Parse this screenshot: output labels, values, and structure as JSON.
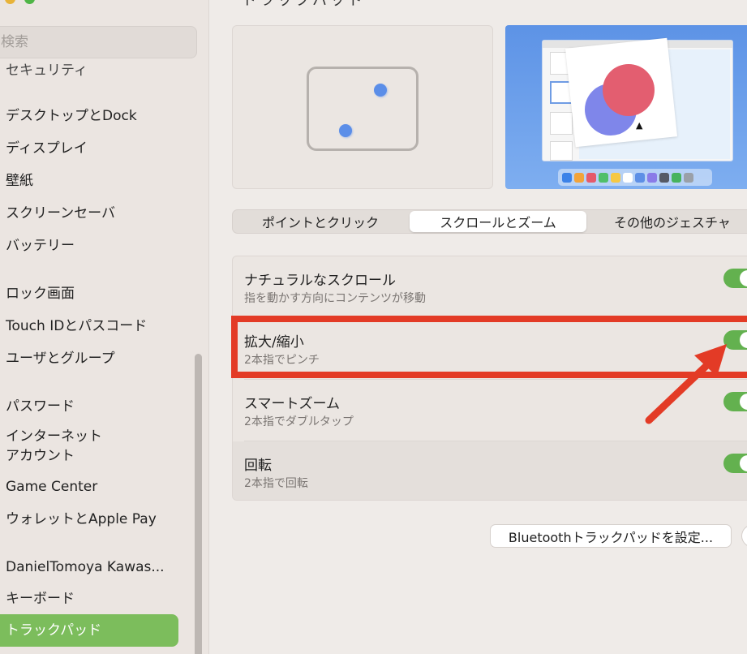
{
  "window": {
    "title": "トラックパッド"
  },
  "sidebar": {
    "search_placeholder": "検索",
    "items": [
      {
        "label": "セキュリティ"
      },
      {
        "label": "デスクトップとDock"
      },
      {
        "label": "ディスプレイ"
      },
      {
        "label": "壁紙"
      },
      {
        "label": "スクリーンセーバ"
      },
      {
        "label": "バッテリー"
      },
      {
        "label": "ロック画面"
      },
      {
        "label": "Touch IDとパスコード"
      },
      {
        "label": "ユーザとグループ"
      },
      {
        "label": "パスワード"
      },
      {
        "label": "インターネット"
      },
      {
        "label": "アカウント"
      },
      {
        "label": "Game Center"
      },
      {
        "label": "ウォレットとApple Pay"
      },
      {
        "label": "DanielTomoya Kawas..."
      },
      {
        "label": "キーボード"
      },
      {
        "label": "トラックパッド",
        "selected": true
      }
    ]
  },
  "tabs": [
    {
      "label": "ポイントとクリック"
    },
    {
      "label": "スクロールとズーム",
      "selected": true
    },
    {
      "label": "その他のジェスチャ"
    }
  ],
  "settings": [
    {
      "label": "ナチュラルなスクロール",
      "description": "指を動かす方向にコンテンツが移動",
      "enabled": true
    },
    {
      "label": "拡大/縮小",
      "description": "2本指でピンチ",
      "enabled": true
    },
    {
      "label": "スマートズーム",
      "description": "2本指でダブルタップ",
      "enabled": true
    },
    {
      "label": "回転",
      "description": "2本指で回転",
      "enabled": true
    }
  ],
  "footer": {
    "bluetooth_button": "Bluetoothトラックパッドを設定..."
  },
  "colors": {
    "accent": "#7cbd5c",
    "toggle_on": "#63b14f",
    "annotation": "#e33b26"
  }
}
